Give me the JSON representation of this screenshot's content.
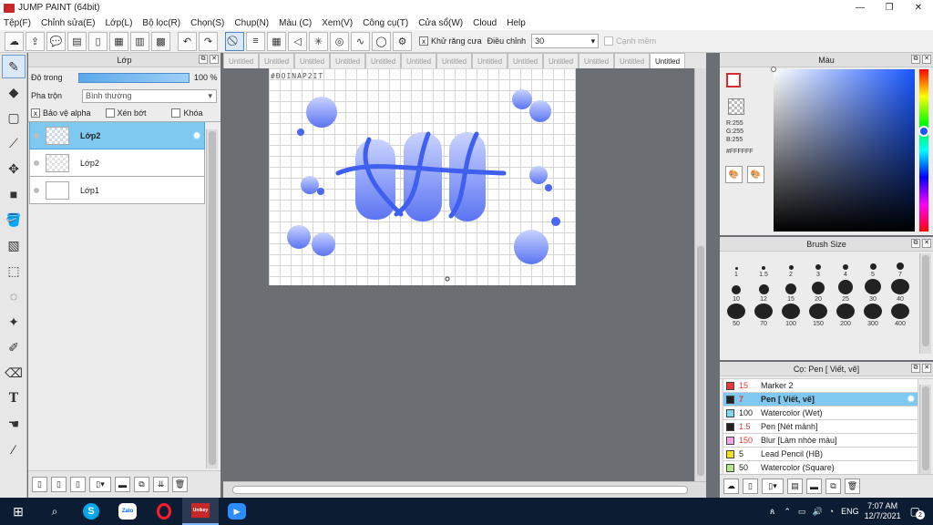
{
  "window": {
    "title": "JUMP PAINT (64bit)",
    "minimize": "—",
    "maximize": "❐",
    "close": "✕"
  },
  "menu": [
    "Tệp(F)",
    "Chỉnh sửa(E)",
    "Lớp(L)",
    "Bộ lọc(R)",
    "Chọn(S)",
    "Chụp(N)",
    "Màu (C)",
    "Xem(V)",
    "Công cụ(T)",
    "Cửa sổ(W)",
    "Cloud",
    "Help"
  ],
  "toolbar": {
    "antialias_label": "Khử răng cưa",
    "antialias_checked": "x",
    "adjust_label": "Điều chỉnh",
    "adjust_value": "30",
    "smooth_label": "Cạnh mềm"
  },
  "layers": {
    "title": "Lớp",
    "opacity_label": "Độ trong",
    "opacity_value": "100 %",
    "opacity_fraction": 1.0,
    "blend_label": "Pha trộn",
    "blend_value": "Bình thường",
    "protect_alpha": "Bảo vệ alpha",
    "clip": "Xén bớt",
    "lock": "Khóa",
    "protect_alpha_checked": "x",
    "items": [
      {
        "name": "Lớp2",
        "active": true
      },
      {
        "name": "Lớp2",
        "active": false
      },
      {
        "name": "Lớp1",
        "active": false
      }
    ]
  },
  "tabs": [
    "Untitled",
    "Untitled",
    "Untitled",
    "Untitled",
    "Untitled",
    "Untitled",
    "Untitled",
    "Untitled",
    "Untitled",
    "Untitled",
    "Untitled",
    "Untitled",
    "Untitled"
  ],
  "canvas": {
    "watermark": "#ĐỌINAP2IT",
    "artwork_text": "taff"
  },
  "color": {
    "title": "Màu",
    "r": "R:255",
    "g": "G:255",
    "b": "B:255",
    "hex": "#FFFFFF",
    "accent": "#1856ff"
  },
  "brush_size": {
    "title": "Brush Size",
    "sizes": [
      "1",
      "1.5",
      "2",
      "3",
      "4",
      "5",
      "7",
      "10",
      "12",
      "15",
      "20",
      "25",
      "30",
      "40",
      "50",
      "70",
      "100",
      "150",
      "200",
      "300",
      "400"
    ]
  },
  "pens": {
    "title": "Cọ: Pen [ Viết, vẽ]",
    "items": [
      {
        "size": "15",
        "name": "Marker 2",
        "color": "#e53935",
        "size_red": true
      },
      {
        "size": "7",
        "name": "Pen [ Viết, vẽ]",
        "color": "#222222",
        "size_red": true,
        "active": true
      },
      {
        "size": "100",
        "name": "Watercolor (Wet)",
        "color": "#7fd8f0",
        "size_red": false
      },
      {
        "size": "1.5",
        "name": "Pen [Nét mảnh]",
        "color": "#222222",
        "size_red": true
      },
      {
        "size": "150",
        "name": "Blur [Làm nhòe màu]",
        "color": "#f4a6e8",
        "size_red": true
      },
      {
        "size": "5",
        "name": "Lead Pencil (HB)",
        "color": "#f0e020",
        "size_red": false
      },
      {
        "size": "50",
        "name": "Watercolor (Square)",
        "color": "#b7e58a",
        "size_red": false
      }
    ]
  },
  "taskbar": {
    "lang": "ENG",
    "time": "7:07 AM",
    "date": "12/7/2021",
    "notifications": "2",
    "apps": [
      "Zalo",
      "Unikey"
    ]
  }
}
